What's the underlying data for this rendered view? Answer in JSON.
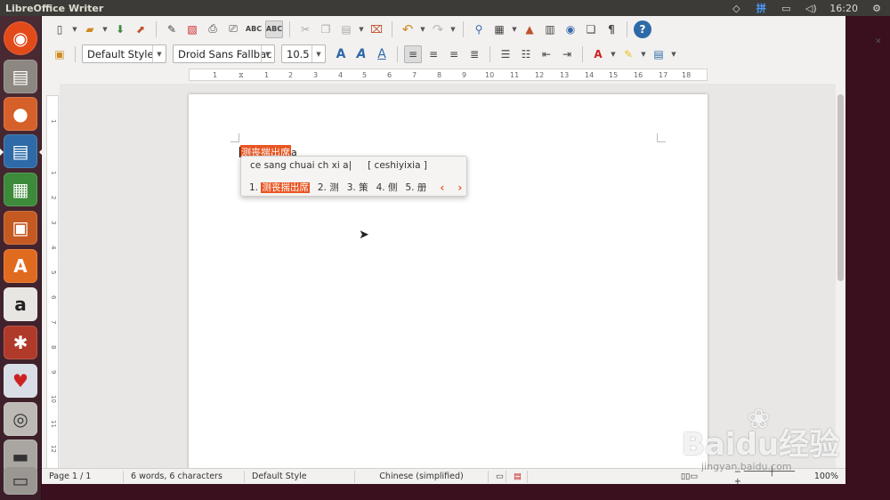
{
  "topbar": {
    "title": "LibreOffice Writer",
    "time": "16:20",
    "ime_indicator": "拼",
    "icons": [
      "wifi-icon",
      "keyboard-icon",
      "battery-icon",
      "volume-icon",
      "gear-icon"
    ]
  },
  "launcher": {
    "items": [
      "ubuntu-dash",
      "files",
      "firefox",
      "writer",
      "calc",
      "impress",
      "software-center",
      "amazon",
      "system-settings",
      "solitaire",
      "camera",
      "disk",
      "trash"
    ]
  },
  "toolbar2": {
    "paragraph_style": "Default Style",
    "font_name": "Droid Sans Fallbac",
    "font_size": "10.5"
  },
  "ruler": {
    "h_ticks": [
      "1",
      "1",
      "2",
      "3",
      "4",
      "5",
      "6",
      "7",
      "8",
      "9",
      "10",
      "11",
      "12",
      "13",
      "14",
      "15",
      "16",
      "17",
      "18"
    ],
    "v_ticks": [
      "1",
      "1",
      "2",
      "3",
      "4",
      "5",
      "6",
      "7",
      "8",
      "9",
      "10",
      "11",
      "12"
    ]
  },
  "document": {
    "typed_highlighted": "测丧揣出席",
    "typed_tail": "a"
  },
  "ime": {
    "preedit": "ce sang chuai ch xi a|",
    "pinyin": "[ ceshiyixia ]",
    "candidates": [
      {
        "index": "1.",
        "text": "测丧揣出席"
      },
      {
        "index": "2.",
        "text": "测"
      },
      {
        "index": "3.",
        "text": "策"
      },
      {
        "index": "4.",
        "text": "侧"
      },
      {
        "index": "5.",
        "text": "册"
      }
    ],
    "prev": "‹",
    "next": "›"
  },
  "status": {
    "page": "Page 1 / 1",
    "words": "6 words, 6 characters",
    "style": "Default Style",
    "language": "Chinese (simplified)",
    "zoom": "100%"
  },
  "watermark": {
    "text": "Baidu经验",
    "url": "jingyan.baidu.com"
  },
  "colors": {
    "accent": "#e95420",
    "panel": "#3c3b37",
    "window_bg": "#f2f1f0"
  }
}
